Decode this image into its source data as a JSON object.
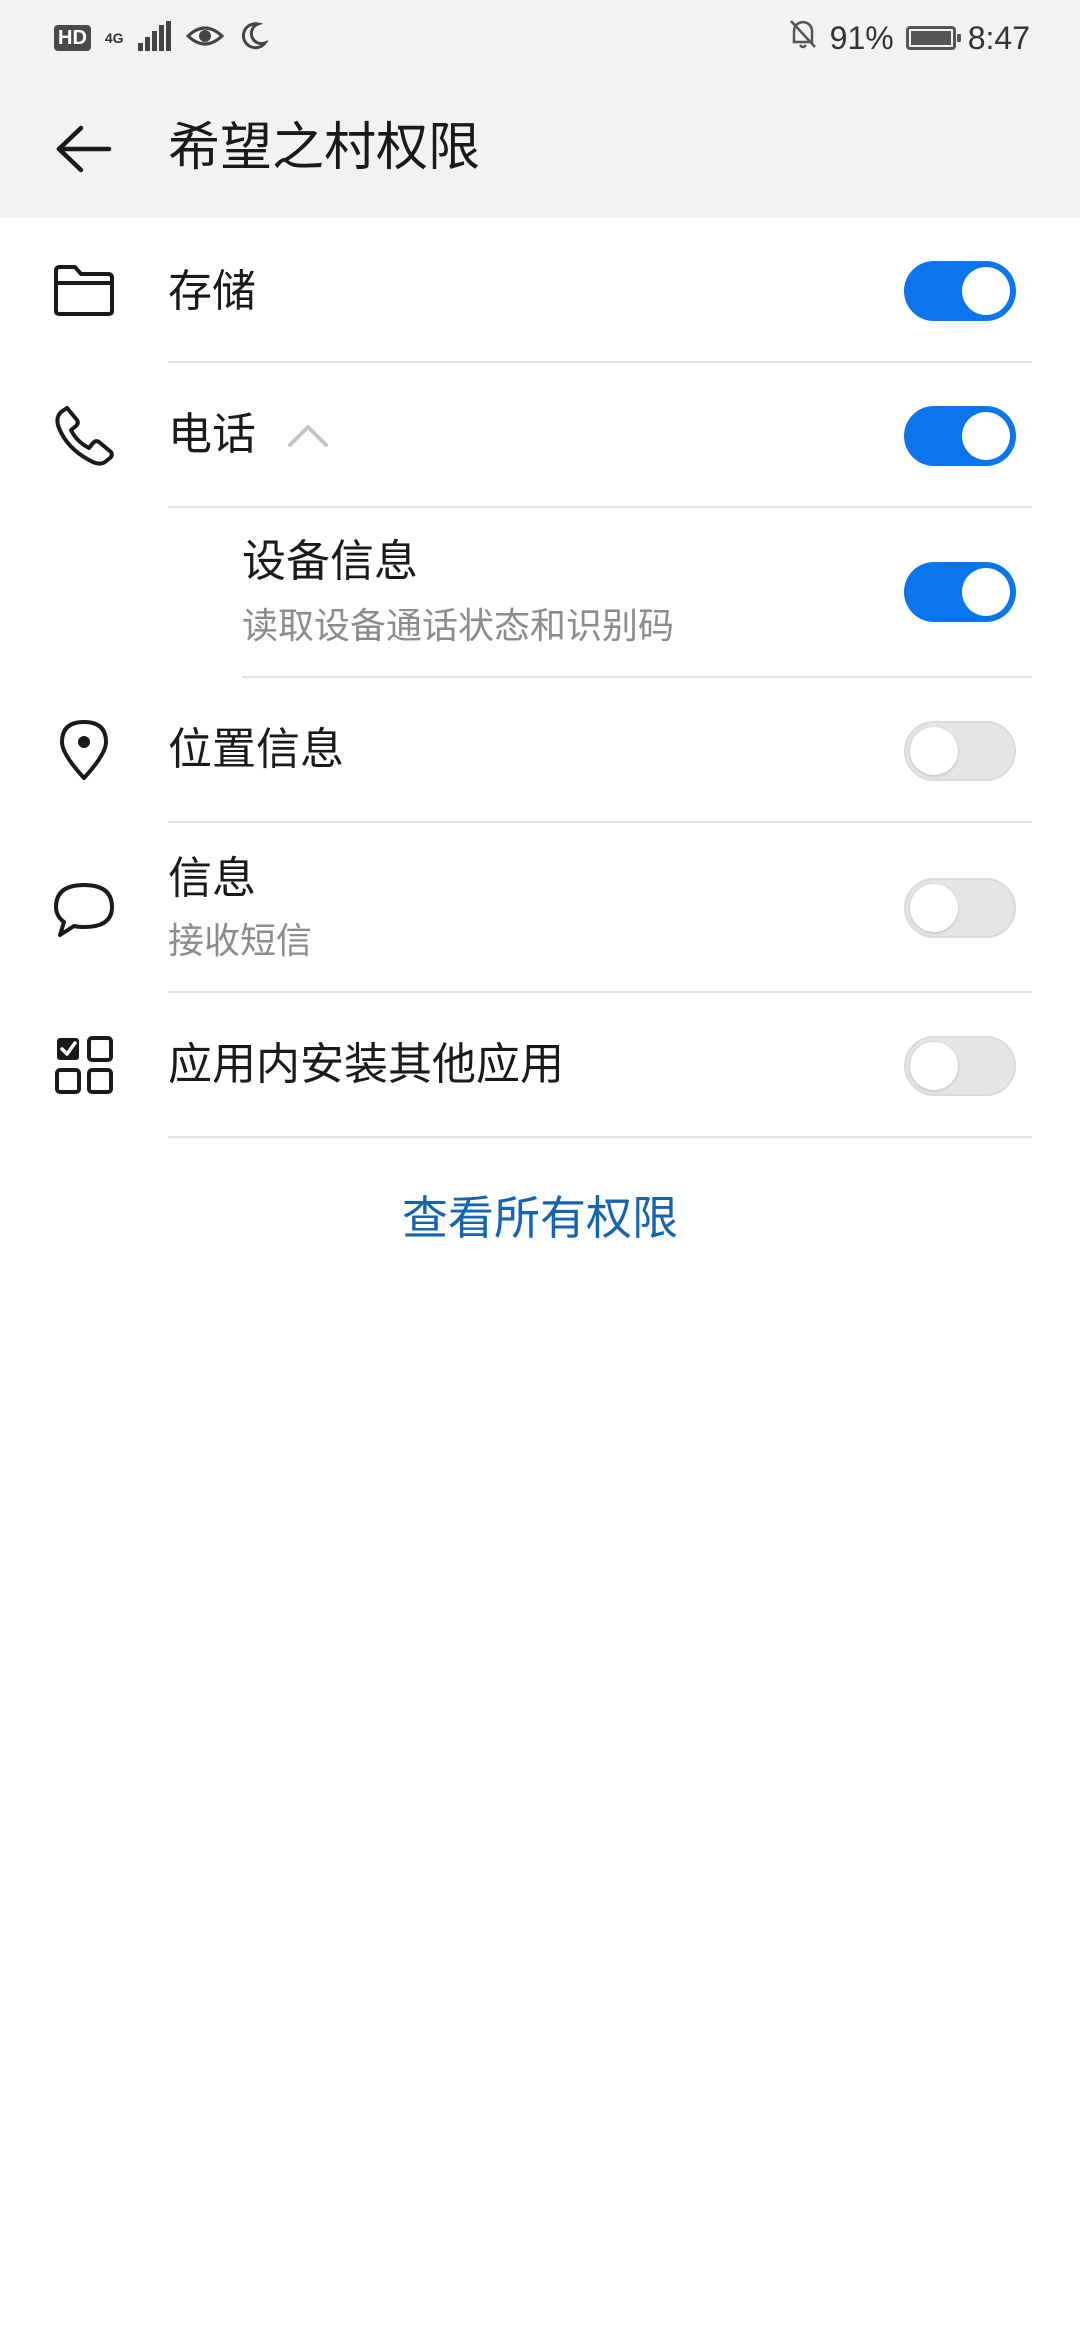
{
  "status_bar": {
    "hd_label": "HD",
    "network_type": "4G",
    "battery_text": "91%",
    "time": "8:47",
    "icons": [
      "signal-icon",
      "eye-icon",
      "moon-icon",
      "bell-off-icon",
      "battery-charging-icon"
    ]
  },
  "header": {
    "title": "希望之村权限",
    "back_icon": "arrow-left-icon"
  },
  "permissions": [
    {
      "icon": "folder-icon",
      "title": "存储",
      "enabled": true
    },
    {
      "icon": "phone-icon",
      "title": "电话",
      "expanded": true,
      "enabled": true,
      "children": [
        {
          "title": "设备信息",
          "subtitle": "读取设备通话状态和识别码",
          "enabled": true
        }
      ]
    },
    {
      "icon": "location-pin-icon",
      "title": "位置信息",
      "enabled": false
    },
    {
      "icon": "chat-bubble-icon",
      "title": "信息",
      "subtitle": "接收短信",
      "enabled": false
    },
    {
      "icon": "app-grid-icon",
      "title": "应用内安装其他应用",
      "enabled": false
    }
  ],
  "footer": {
    "view_all_label": "查看所有权限"
  },
  "colors": {
    "header_bg": "#f2f2f2",
    "toggle_on": "#0a75ed",
    "toggle_off": "#e6e6e6",
    "link": "#1564b4",
    "subtitle": "#8c8c8c",
    "divider": "#e3e3e3"
  }
}
